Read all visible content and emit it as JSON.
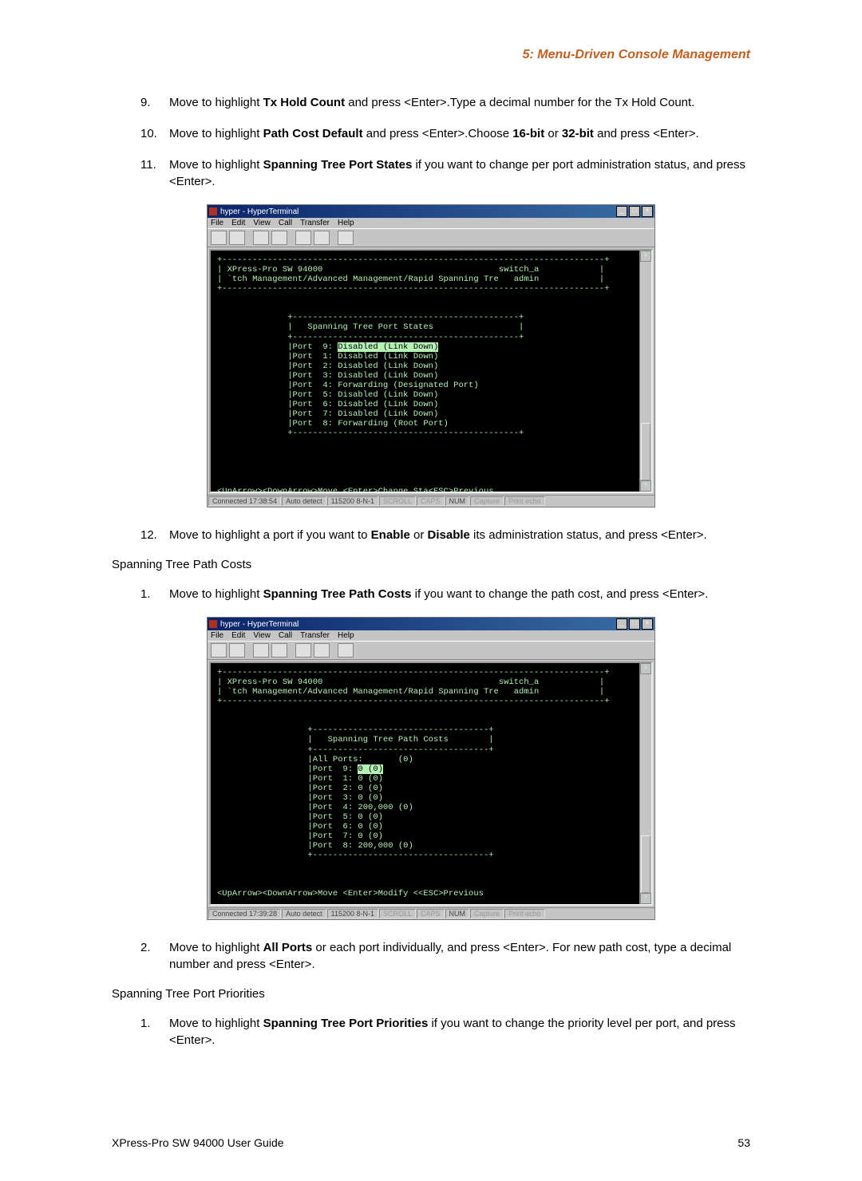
{
  "header": {
    "section": "5: Menu-Driven Console Management"
  },
  "steps_a": [
    {
      "num": "9.",
      "pre": "Move to highlight ",
      "b1": "Tx Hold Count",
      "mid": " and press <Enter>.Type a decimal number for the Tx Hold Count."
    },
    {
      "num": "10.",
      "pre": "Move to highlight ",
      "b1": "Path Cost Default",
      "mid": " and press <Enter>.Choose ",
      "b2": "16-bit",
      "mid2": " or ",
      "b3": "32-bit",
      "tail": " and press <Enter>."
    },
    {
      "num": "11.",
      "pre": "Move to highlight ",
      "b1": "Spanning Tree Port States",
      "mid": " if you want to change per port administration status, and press <Enter>."
    }
  ],
  "steps_b": [
    {
      "num": "12.",
      "pre": "Move to highlight a port if you want to ",
      "b1": "Enable",
      "mid": " or ",
      "b2": "Disable",
      "tail": " its administration status, and press <Enter>."
    }
  ],
  "subheading_b": "Spanning Tree Path Costs",
  "steps_c": [
    {
      "num": "1.",
      "pre": "Move to highlight ",
      "b1": "Spanning Tree Path Costs",
      "mid": " if you want to change the path cost, and press <Enter>."
    }
  ],
  "steps_d": [
    {
      "num": "2.",
      "pre": "Move to highlight ",
      "b1": "All Ports",
      "mid": " or each port individually, and press <Enter>. For new path cost, type a decimal number and press <Enter>."
    }
  ],
  "subheading_d": "Spanning Tree Port Priorities",
  "steps_e": [
    {
      "num": "1.",
      "pre": "Move to highlight ",
      "b1": "Spanning Tree Port Priorities",
      "mid": " if you want to change the priority level per port, and press <Enter>."
    }
  ],
  "terminal": {
    "title": "hyper - HyperTerminal",
    "menus": [
      "File",
      "Edit",
      "View",
      "Call",
      "Transfer",
      "Help"
    ],
    "device": "XPress-Pro SW 94000",
    "right1": "switch_a",
    "right2": "admin",
    "breadcrumb": "`tch Management/Advanced Management/Rapid Spanning Tree Protocol",
    "box1_title": "Spanning Tree Port States",
    "box1_lines_pre": "|Port  9: ",
    "box1_hl": "Disabled (Link Down)",
    "box1_rest": [
      "|Port  1: Disabled (Link Down)",
      "|Port  2: Disabled (Link Down)",
      "|Port  3: Disabled (Link Down)",
      "|Port  4: Forwarding (Designated Port)",
      "|Port  5: Disabled (Link Down)",
      "|Port  6: Disabled (Link Down)",
      "|Port  7: Disabled (Link Down)",
      "|Port  8: Forwarding (Root Port)"
    ],
    "cmd1": "<UpArrow><DownArrow>Move <Enter>Change Status <L>Switch",
    "esc": "<ESC>Previous",
    "box2_title": "Spanning Tree Path Costs",
    "box2_lines": [
      "|All Ports:       (0)",
      "|Port  9: ",
      "|Port  1: 0 (0)",
      "|Port  2: 0 (0)",
      "|Port  3: 0 (0)",
      "|Port  4: 200,000 (0)",
      "|Port  5: 0 (0)",
      "|Port  6: 0 (0)",
      "|Port  7: 0 (0)",
      "|Port  8: 200,000 (0)"
    ],
    "box2_hl": "0 (0)",
    "cmd2": "<UpArrow><DownArrow>Move <Enter>Modify <L>Switch",
    "status": {
      "time1": "Connected 17:38:54",
      "time2": "Connected 17:39:28",
      "auto": "Auto detect",
      "baud": "115200 8-N-1",
      "scroll": "SCROLL",
      "caps": "CAPS",
      "num": "NUM",
      "capture": "Capture",
      "print": "Print echo"
    }
  },
  "footer": {
    "left": "XPress-Pro SW 94000 User Guide",
    "right": "53"
  }
}
